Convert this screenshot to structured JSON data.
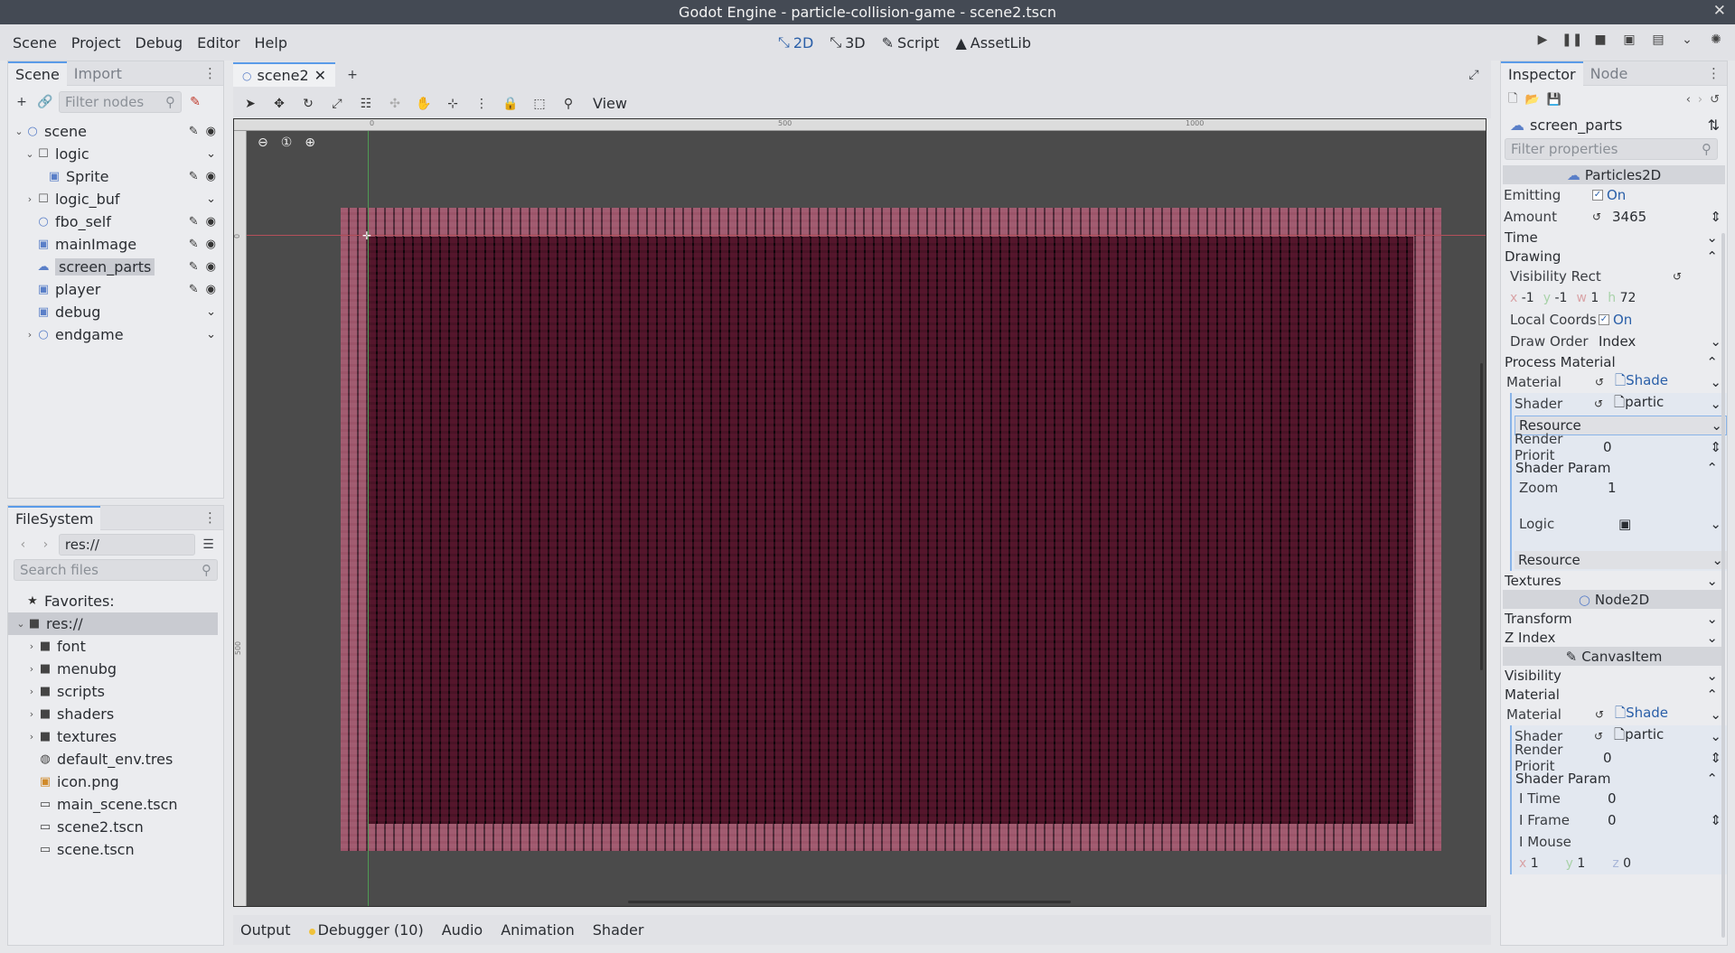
{
  "window": {
    "title": "Godot Engine - particle-collision-game - scene2.tscn"
  },
  "menu": [
    "Scene",
    "Project",
    "Debug",
    "Editor",
    "Help"
  ],
  "workspaces": [
    {
      "label": "2D",
      "icon": "2d-icon",
      "active": true
    },
    {
      "label": "3D",
      "icon": "3d-icon",
      "active": false
    },
    {
      "label": "Script",
      "icon": "script-icon",
      "active": false
    },
    {
      "label": "AssetLib",
      "icon": "assetlib-icon",
      "active": false
    }
  ],
  "scene_dock": {
    "tabs": [
      "Scene",
      "Import"
    ],
    "filter_placeholder": "Filter nodes",
    "nodes": [
      {
        "name": "scene",
        "depth": 0,
        "icon": "node2d-icon",
        "expanded": true,
        "script": true,
        "visible": true
      },
      {
        "name": "logic",
        "depth": 1,
        "icon": "control-icon",
        "expanded": true,
        "script": false,
        "visible": false
      },
      {
        "name": "Sprite",
        "depth": 2,
        "icon": "sprite-icon",
        "expanded": false,
        "script": true,
        "visible": true
      },
      {
        "name": "logic_buf",
        "depth": 1,
        "icon": "control-icon",
        "expanded": false,
        "script": false,
        "visible": false
      },
      {
        "name": "fbo_self",
        "depth": 1,
        "icon": "node2d-icon",
        "expanded": false,
        "script": true,
        "visible": true
      },
      {
        "name": "mainImage",
        "depth": 1,
        "icon": "sprite-icon",
        "expanded": false,
        "script": true,
        "visible": true
      },
      {
        "name": "screen_parts",
        "depth": 1,
        "icon": "particles-icon",
        "expanded": false,
        "script": true,
        "visible": true,
        "selected": true
      },
      {
        "name": "player",
        "depth": 1,
        "icon": "sprite-icon",
        "expanded": false,
        "script": true,
        "visible": true
      },
      {
        "name": "debug",
        "depth": 1,
        "icon": "sprite-icon",
        "expanded": false,
        "script": false,
        "visible": false
      },
      {
        "name": "endgame",
        "depth": 1,
        "icon": "node2d-icon",
        "expanded": false,
        "script": false,
        "visible": false
      }
    ]
  },
  "filesystem": {
    "tab": "FileSystem",
    "path": "res://",
    "search_placeholder": "Search files",
    "favorites": "Favorites:",
    "root": "res://",
    "folders": [
      "font",
      "menubg",
      "scripts",
      "shaders",
      "textures"
    ],
    "files": [
      "default_env.tres",
      "icon.png",
      "main_scene.tscn",
      "scene2.tscn",
      "scene.tscn"
    ]
  },
  "editor": {
    "scene_tab": "scene2",
    "view_menu": "View",
    "ruler_marks": [
      "0",
      "500",
      "1000"
    ],
    "ruler_left_marks": [
      "0",
      "500"
    ]
  },
  "bottom_panel": [
    "Output",
    "Debugger (10)",
    "Audio",
    "Animation",
    "Shader"
  ],
  "inspector": {
    "tabs": [
      "Inspector",
      "Node"
    ],
    "node_name": "screen_parts",
    "filter_placeholder": "Filter properties",
    "sections": {
      "particles": "Particles2D",
      "node2d": "Node2D",
      "canvas": "CanvasItem"
    },
    "props": {
      "emitting": "Emitting",
      "emitting_val": "On",
      "amount": "Amount",
      "amount_val": "3465",
      "time": "Time",
      "drawing": "Drawing",
      "vis_rect": "Visibility Rect",
      "vr_x": "-1",
      "vr_y": "-1",
      "vr_w": "1",
      "vr_h": "72",
      "local_coords": "Local Coords",
      "local_coords_val": "On",
      "draw_order": "Draw Order",
      "draw_order_val": "Index",
      "process_material": "Process Material",
      "material": "Material",
      "material_val": "Shade",
      "shader": "Shader",
      "shader_val": "partic",
      "resource": "Resource",
      "render_priority": "Render Priorit",
      "render_priority_val": "0",
      "shader_param": "Shader Param",
      "zoom": "Zoom",
      "zoom_val": "1",
      "logic": "Logic",
      "textures": "Textures",
      "transform": "Transform",
      "z_index": "Z Index",
      "visibility": "Visibility",
      "material_group": "Material",
      "material2_val": "Shade",
      "shader2_val": "partic",
      "render_priority2_val": "0",
      "itime": "I Time",
      "itime_val": "0",
      "iframe": "I Frame",
      "iframe_val": "0",
      "imouse": "I Mouse",
      "im_x": "1",
      "im_y": "1",
      "im_z": "0"
    }
  },
  "colors": {
    "accent": "#5a9be8",
    "particle_pink": "#c86e87",
    "viewport_bg": "#4b4b4b"
  }
}
